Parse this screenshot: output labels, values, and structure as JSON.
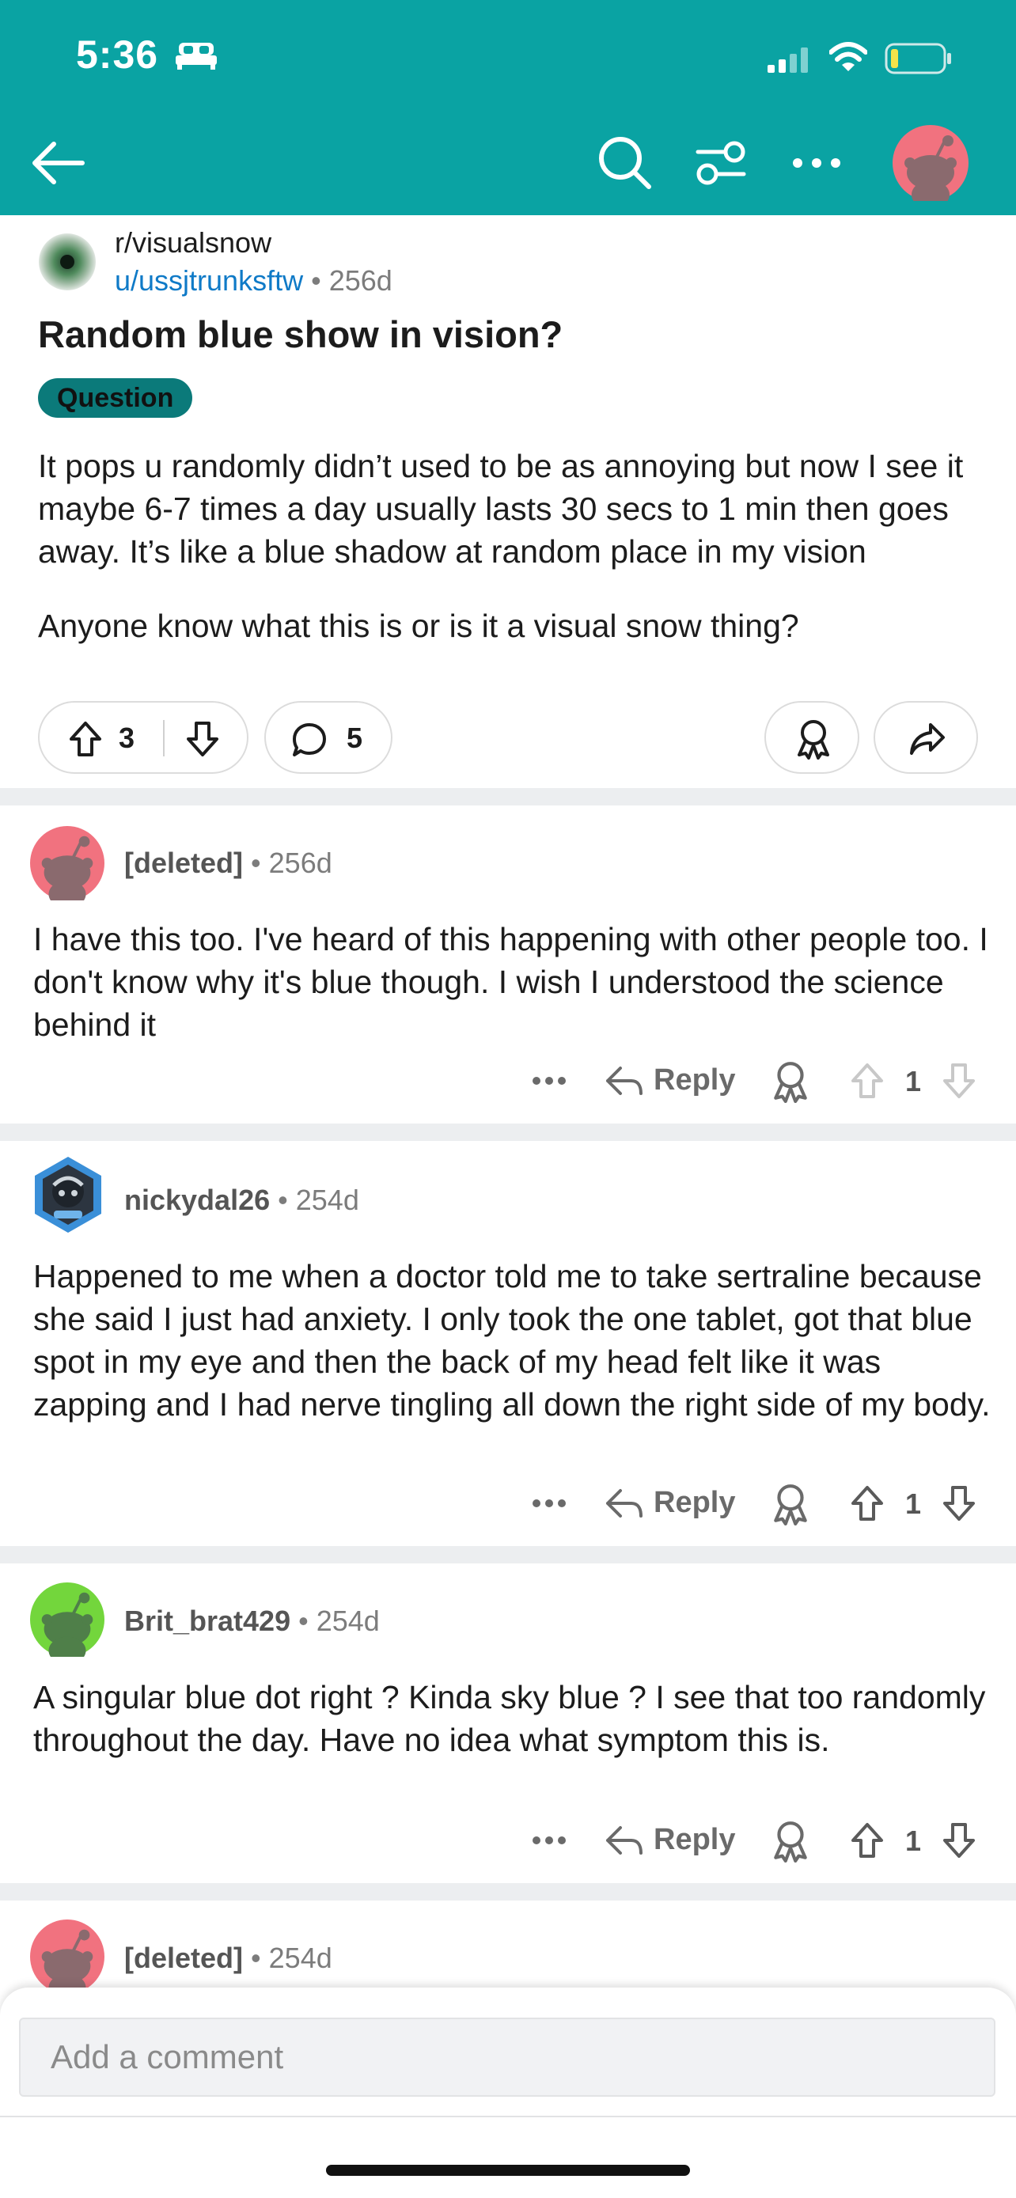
{
  "status_bar": {
    "time": "5:36"
  },
  "colors": {
    "header_bg": "#0aa3a3",
    "link": "#0f7ac7",
    "flair_bg": "#0b7a7a"
  },
  "header": {
    "icons": [
      "back-arrow-icon",
      "search-icon",
      "filter-icon",
      "more-icon",
      "avatar"
    ]
  },
  "post": {
    "subreddit": "r/visualsnow",
    "author": "u/ussjtrunksftw",
    "age": "256d",
    "title": "Random blue show in vision?",
    "flair": "Question",
    "body": [
      "It pops u randomly didn’t used to be as annoying but now I see it maybe 6-7 times a day usually lasts 30 secs to 1 min then goes away. It’s like a blue shadow at random place in my vision",
      "Anyone know what this is or is it a visual snow thing?"
    ],
    "score": "3",
    "comment_count": "5"
  },
  "comments": [
    {
      "author": "[deleted]",
      "age": "256d",
      "body": "I have this too. I've heard of this happening with other people too. I don't know why it's blue though. I wish I understood the science behind it",
      "reply_label": "Reply",
      "votes": "1"
    },
    {
      "author": "nickydal26",
      "age": "254d",
      "body": "Happened to me when a doctor told me to take sertraline because she said I just had anxiety. I only took the one tablet, got that blue spot in my eye and then the back of my head felt like it was zapping and I had nerve tingling all down the right side of my body.",
      "reply_label": "Reply",
      "votes": "1"
    },
    {
      "author": "Brit_brat429",
      "age": "254d",
      "body": "A singular blue dot right ? Kinda sky blue ? I see that too randomly throughout the day. Have no idea what symptom this is.",
      "reply_label": "Reply",
      "votes": "1"
    },
    {
      "author": "[deleted]",
      "age": "254d"
    }
  ],
  "compose": {
    "placeholder": "Add a comment"
  },
  "separator": "•"
}
